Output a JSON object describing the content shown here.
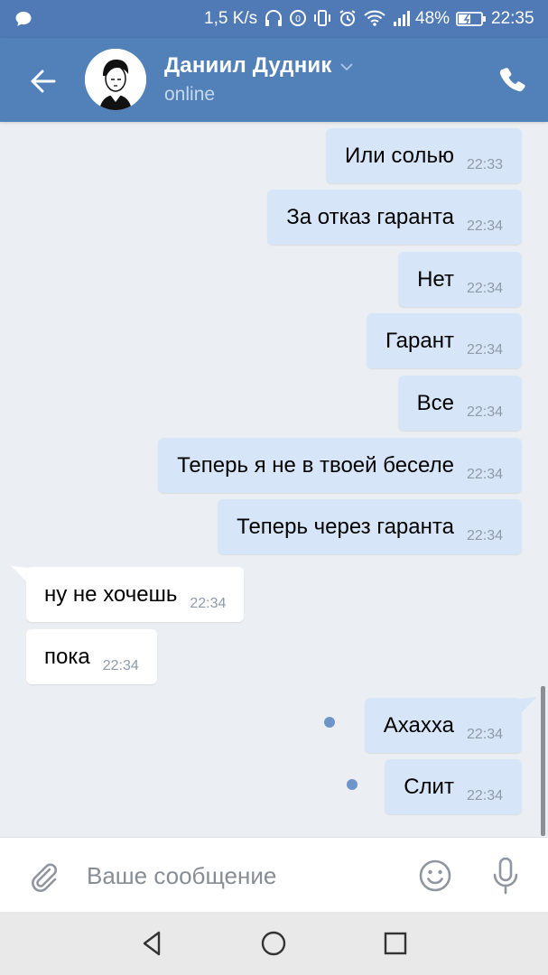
{
  "status_bar": {
    "speed": "1,5 K/s",
    "battery_percent": "48%",
    "time": "22:35",
    "icons": [
      "message-icon",
      "headphones-icon",
      "data-saver-icon",
      "vibrate-icon",
      "alarm-icon",
      "wifi-icon",
      "signal-icon",
      "battery-icon"
    ]
  },
  "header": {
    "contact_name": "Даниил Дудник",
    "status": "online",
    "accent_color": "#5181b8"
  },
  "messages": [
    {
      "direction": "out",
      "text": "Или солью",
      "time": "22:33",
      "unread": false
    },
    {
      "direction": "out",
      "text": "За отказ гаранта",
      "time": "22:34",
      "unread": false
    },
    {
      "direction": "out",
      "text": "Нет",
      "time": "22:34",
      "unread": false
    },
    {
      "direction": "out",
      "text": "Гарант",
      "time": "22:34",
      "unread": false
    },
    {
      "direction": "out",
      "text": "Все",
      "time": "22:34",
      "unread": false
    },
    {
      "direction": "out",
      "text": "Теперь я не в твоей беселе",
      "time": "22:34",
      "unread": false
    },
    {
      "direction": "out",
      "text": "Теперь через гаранта",
      "time": "22:34",
      "unread": false
    },
    {
      "direction": "in",
      "text": "ну не хочешь",
      "time": "22:34",
      "unread": false
    },
    {
      "direction": "in",
      "text": "пока",
      "time": "22:34",
      "unread": false
    },
    {
      "direction": "out",
      "text": "Ахахха",
      "time": "22:34",
      "unread": true
    },
    {
      "direction": "out",
      "text": "Слит",
      "time": "22:34",
      "unread": true
    }
  ],
  "composer": {
    "placeholder": "Ваше сообщение",
    "value": ""
  },
  "colors": {
    "outgoing_bubble": "#d6e6f8",
    "incoming_bubble": "#ffffff",
    "chat_background": "#ebeef2",
    "unread_dot": "#6e95c8"
  }
}
